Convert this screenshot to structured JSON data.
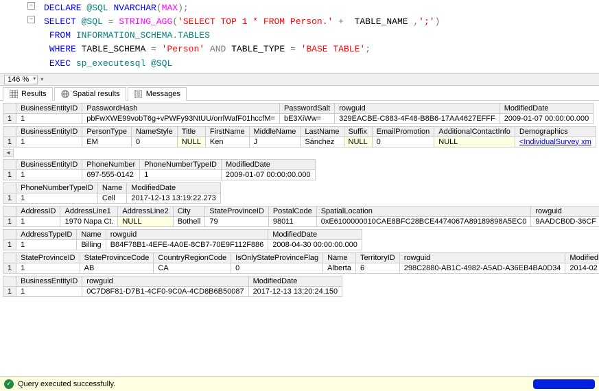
{
  "editor": {
    "lines": [
      {
        "collapse": true,
        "tokens": [
          [
            "kw",
            "DECLARE"
          ],
          [
            "",
            ""
          ],
          [
            "id",
            " @SQL"
          ],
          [
            "",
            " "
          ],
          [
            "kw",
            "NVARCHAR"
          ],
          [
            "op",
            "("
          ],
          [
            "fn",
            "MAX"
          ],
          [
            "op",
            ");"
          ]
        ]
      },
      {
        "collapse": true,
        "tokens": [
          [
            "kw",
            "SELECT"
          ],
          [
            "",
            " "
          ],
          [
            "id",
            "@SQL"
          ],
          [
            "op",
            " = "
          ],
          [
            "fn",
            "STRING_AGG"
          ],
          [
            "op",
            "("
          ],
          [
            "str",
            "'SELECT TOP 1 * FROM Person.'"
          ],
          [
            "op",
            " + "
          ],
          [
            "",
            " TABLE_NAME "
          ],
          [
            "op",
            ","
          ],
          [
            "str",
            "';'"
          ],
          [
            "op",
            ")"
          ]
        ]
      },
      {
        "tokens": [
          [
            "",
            " "
          ],
          [
            "kw",
            "FROM"
          ],
          [
            "",
            " "
          ],
          [
            "id",
            "INFORMATION_SCHEMA"
          ],
          [
            "op",
            "."
          ],
          [
            "id",
            "TABLES"
          ]
        ]
      },
      {
        "tokens": [
          [
            "",
            " "
          ],
          [
            "kw",
            "WHERE"
          ],
          [
            "",
            " TABLE_SCHEMA "
          ],
          [
            "op",
            "="
          ],
          [
            "",
            " "
          ],
          [
            "str",
            "'Person'"
          ],
          [
            "",
            " "
          ],
          [
            "op",
            "AND"
          ],
          [
            "",
            " TABLE_TYPE "
          ],
          [
            "op",
            "="
          ],
          [
            "",
            " "
          ],
          [
            "str",
            "'BASE TABLE'"
          ],
          [
            "op",
            ";"
          ]
        ]
      },
      {
        "tokens": [
          [
            "",
            " "
          ],
          [
            "kw",
            "EXEC"
          ],
          [
            "",
            " "
          ],
          [
            "id",
            "sp_executesql"
          ],
          [
            "",
            " "
          ],
          [
            "id",
            "@SQL"
          ]
        ]
      }
    ]
  },
  "zoom": "146 %",
  "tabs": {
    "results": "Results",
    "spatial": "Spatial results",
    "messages": "Messages"
  },
  "null_text": "NULL",
  "grids": [
    {
      "headers": [
        "BusinessEntityID",
        "PasswordHash",
        "PasswordSalt",
        "rowguid",
        "ModifiedDate"
      ],
      "row": [
        "1",
        "pbFwXWE99vobT6g+vPWFy93NtUU/orrlWafF01hccfM=",
        "bE3XiWw=",
        "329EACBE-C883-4F48-B8B6-17AA4627EFFF",
        "2009-01-07 00:00:00.000"
      ],
      "nulls": []
    },
    {
      "headers": [
        "BusinessEntityID",
        "PersonType",
        "NameStyle",
        "Title",
        "FirstName",
        "MiddleName",
        "LastName",
        "Suffix",
        "EmailPromotion",
        "AdditionalContactInfo",
        "Demographics"
      ],
      "row": [
        "1",
        "EM",
        "0",
        "NULL",
        "Ken",
        "J",
        "Sánchez",
        "NULL",
        "0",
        "NULL",
        "<IndividualSurvey xm"
      ],
      "nulls": [
        3,
        7,
        9
      ],
      "link": 10,
      "scrollhint": true
    },
    {
      "headers": [
        "BusinessEntityID",
        "PhoneNumber",
        "PhoneNumberTypeID",
        "ModifiedDate"
      ],
      "row": [
        "1",
        "697-555-0142",
        "1",
        "2009-01-07 00:00:00.000"
      ],
      "nulls": []
    },
    {
      "headers": [
        "PhoneNumberTypeID",
        "Name",
        "ModifiedDate"
      ],
      "row": [
        "1",
        "Cell",
        "2017-12-13 13:19:22.273"
      ],
      "nulls": []
    },
    {
      "headers": [
        "AddressID",
        "AddressLine1",
        "AddressLine2",
        "City",
        "StateProvinceID",
        "PostalCode",
        "SpatialLocation",
        "rowguid"
      ],
      "row": [
        "1",
        "1970 Napa Ct.",
        "NULL",
        "Bothell",
        "79",
        "98011",
        "0xE6100000010CAE8BFC28BCE4474067A89189898A5EC0",
        "9AADCB0D-36CF"
      ],
      "nulls": [
        2
      ]
    },
    {
      "headers": [
        "AddressTypeID",
        "Name",
        "rowguid",
        "ModifiedDate"
      ],
      "row": [
        "1",
        "Billing",
        "B84F78B1-4EFE-4A0E-8CB7-70E9F112F886",
        "2008-04-30 00:00:00.000"
      ],
      "nulls": []
    },
    {
      "headers": [
        "StateProvinceID",
        "StateProvinceCode",
        "CountryRegionCode",
        "IsOnlyStateProvinceFlag",
        "Name",
        "TerritoryID",
        "rowguid",
        "ModifiedD"
      ],
      "row": [
        "1",
        "AB",
        "CA",
        "0",
        "Alberta",
        "6",
        "298C2880-AB1C-4982-A5AD-A36EB4BA0D34",
        "2014-02"
      ],
      "nulls": []
    },
    {
      "headers": [
        "BusinessEntityID",
        "rowguid",
        "ModifiedDate"
      ],
      "row": [
        "1",
        "0C7D8F81-D7B1-4CF0-9C0A-4CD8B6B50087",
        "2017-12-13 13:20:24.150"
      ],
      "nulls": []
    }
  ],
  "status": "Query executed successfully."
}
